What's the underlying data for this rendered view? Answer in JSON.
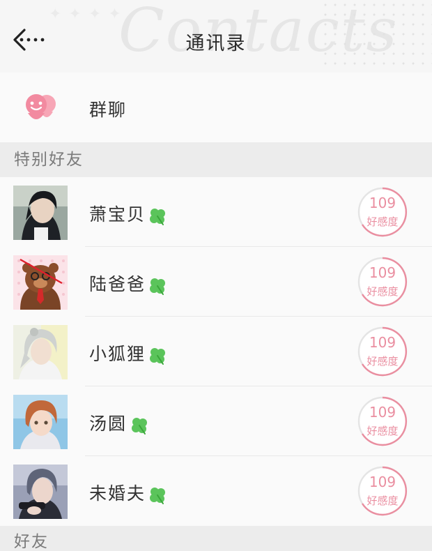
{
  "header": {
    "title": "通讯录",
    "watermark": "Contacts"
  },
  "group_chat": {
    "label": "群聊"
  },
  "sections": {
    "special": "特别好友",
    "friends": "好友"
  },
  "friends": [
    {
      "name": "萧宝贝",
      "affinity": "109",
      "affinity_label": "好感度"
    },
    {
      "name": "陆爸爸",
      "affinity": "109",
      "affinity_label": "好感度"
    },
    {
      "name": "小狐狸",
      "affinity": "109",
      "affinity_label": "好感度"
    },
    {
      "name": "汤圆",
      "affinity": "109",
      "affinity_label": "好感度"
    },
    {
      "name": "未婚夫",
      "affinity": "109",
      "affinity_label": "好感度"
    }
  ],
  "colors": {
    "accent_pink": "#ea8ea0",
    "clover_green": "#5bc45b",
    "group_icon": "#f28aa0"
  }
}
